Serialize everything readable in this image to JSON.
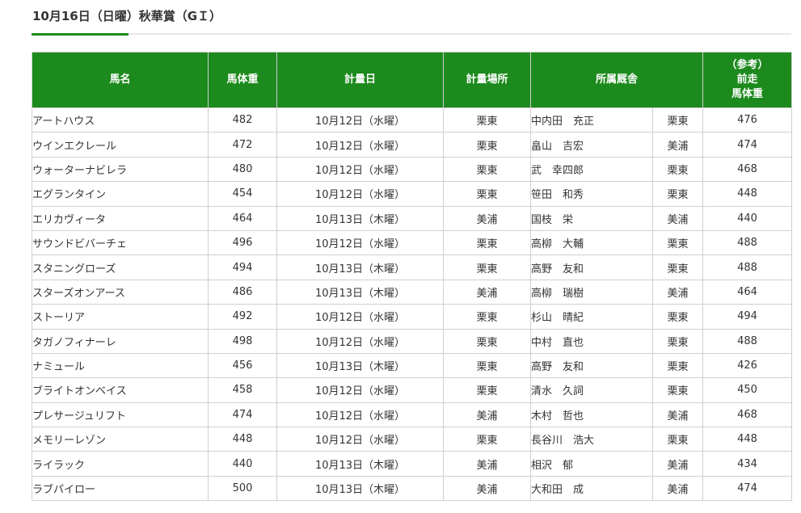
{
  "page": {
    "title": "10月16日（日曜）秋華賞（GＩ）"
  },
  "table": {
    "headers": {
      "name": "馬名",
      "weight": "馬体重",
      "date": "計量日",
      "place": "計量場所",
      "stable": "所属厩舎",
      "prev_line1": "（参考）",
      "prev_line2": "前走",
      "prev_line3": "馬体重"
    },
    "rows": [
      {
        "name": "アートハウス",
        "weight": "482",
        "date": "10月12日（水曜）",
        "place": "栗東",
        "trainer": "中内田　充正",
        "belong": "栗東",
        "prev": "476"
      },
      {
        "name": "ウインエクレール",
        "weight": "472",
        "date": "10月12日（水曜）",
        "place": "栗東",
        "trainer": "畠山　吉宏",
        "belong": "美浦",
        "prev": "474"
      },
      {
        "name": "ウォーターナビレラ",
        "weight": "480",
        "date": "10月12日（水曜）",
        "place": "栗東",
        "trainer": "武　幸四郎",
        "belong": "栗東",
        "prev": "468"
      },
      {
        "name": "エグランタイン",
        "weight": "454",
        "date": "10月12日（水曜）",
        "place": "栗東",
        "trainer": "笹田　和秀",
        "belong": "栗東",
        "prev": "448"
      },
      {
        "name": "エリカヴィータ",
        "weight": "464",
        "date": "10月13日（木曜）",
        "place": "美浦",
        "trainer": "国枝　栄",
        "belong": "美浦",
        "prev": "440"
      },
      {
        "name": "サウンドビバーチェ",
        "weight": "496",
        "date": "10月12日（水曜）",
        "place": "栗東",
        "trainer": "高柳　大輔",
        "belong": "栗東",
        "prev": "488"
      },
      {
        "name": "スタニングローズ",
        "weight": "494",
        "date": "10月13日（木曜）",
        "place": "栗東",
        "trainer": "高野　友和",
        "belong": "栗東",
        "prev": "488"
      },
      {
        "name": "スターズオンアース",
        "weight": "486",
        "date": "10月13日（木曜）",
        "place": "美浦",
        "trainer": "高柳　瑞樹",
        "belong": "美浦",
        "prev": "464"
      },
      {
        "name": "ストーリア",
        "weight": "492",
        "date": "10月12日（水曜）",
        "place": "栗東",
        "trainer": "杉山　晴紀",
        "belong": "栗東",
        "prev": "494"
      },
      {
        "name": "タガノフィナーレ",
        "weight": "498",
        "date": "10月12日（水曜）",
        "place": "栗東",
        "trainer": "中村　直也",
        "belong": "栗東",
        "prev": "488"
      },
      {
        "name": "ナミュール",
        "weight": "456",
        "date": "10月13日（木曜）",
        "place": "栗東",
        "trainer": "高野　友和",
        "belong": "栗東",
        "prev": "426"
      },
      {
        "name": "ブライトオンベイス",
        "weight": "458",
        "date": "10月12日（水曜）",
        "place": "栗東",
        "trainer": "清水　久詞",
        "belong": "栗東",
        "prev": "450"
      },
      {
        "name": "プレサージュリフト",
        "weight": "474",
        "date": "10月12日（水曜）",
        "place": "美浦",
        "trainer": "木村　哲也",
        "belong": "美浦",
        "prev": "468"
      },
      {
        "name": "メモリーレゾン",
        "weight": "448",
        "date": "10月12日（水曜）",
        "place": "栗東",
        "trainer": "長谷川　浩大",
        "belong": "栗東",
        "prev": "448"
      },
      {
        "name": "ライラック",
        "weight": "440",
        "date": "10月13日（木曜）",
        "place": "美浦",
        "trainer": "相沢　郁",
        "belong": "美浦",
        "prev": "434"
      },
      {
        "name": "ラブパイロー",
        "weight": "500",
        "date": "10月13日（木曜）",
        "place": "美浦",
        "trainer": "大和田　成",
        "belong": "美浦",
        "prev": "474"
      }
    ]
  },
  "colors": {
    "header_bg": "#1d8a1d",
    "accent": "#1d8a1d",
    "border": "#cfcfcf",
    "text": "#333333"
  }
}
